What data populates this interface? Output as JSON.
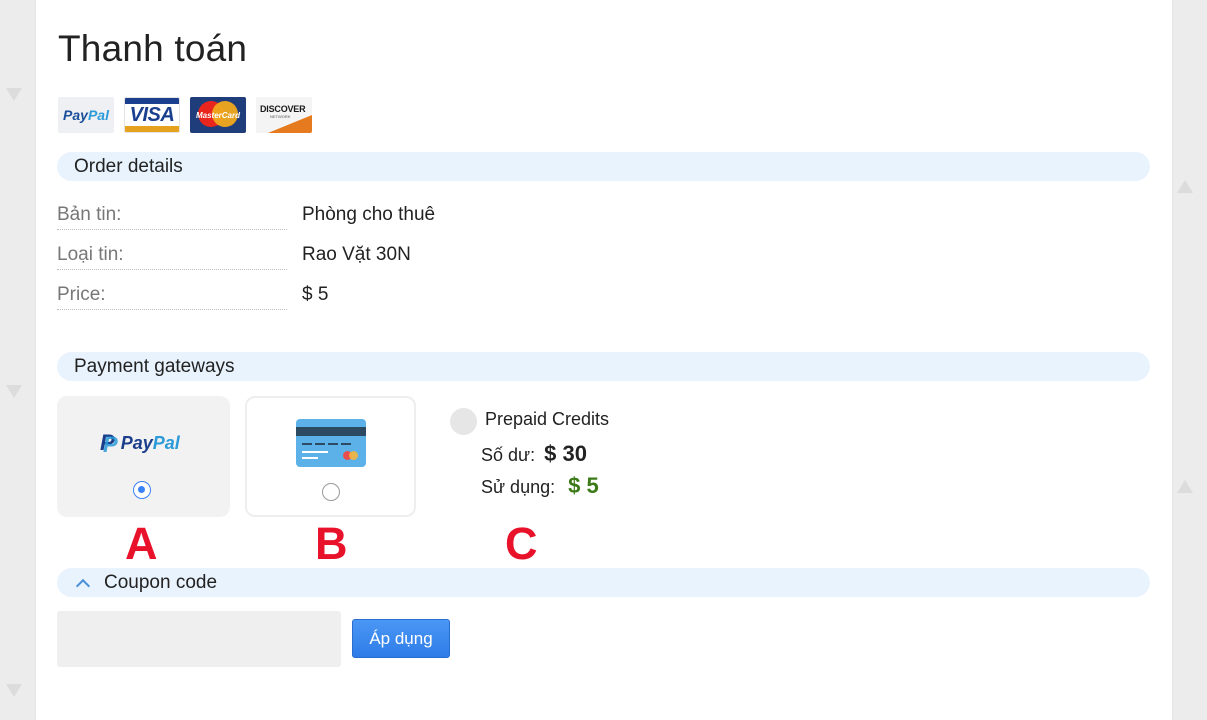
{
  "page": {
    "title": "Thanh toán"
  },
  "accepted_cards": [
    {
      "name": "paypal",
      "label_a": "Pay",
      "label_b": "Pal"
    },
    {
      "name": "visa",
      "label": "VISA"
    },
    {
      "name": "mastercard",
      "label": "MasterCard"
    },
    {
      "name": "discover",
      "label": "DISCOVER",
      "sub": "NETWORK"
    }
  ],
  "order_details": {
    "heading": "Order details",
    "rows": [
      {
        "label": "Bản tin:",
        "value": "Phòng cho thuê"
      },
      {
        "label": "Loại tin:",
        "value": "Rao Vặt 30N"
      },
      {
        "label": "Price:",
        "value": "$ 5"
      }
    ]
  },
  "payment_gateways": {
    "heading": "Payment gateways",
    "paypal": {
      "logo_a": "Pay",
      "logo_b": "Pal",
      "selected": true
    },
    "card": {
      "selected": false
    },
    "prepaid": {
      "title": "Prepaid Credits",
      "balance_label": "Số dư:",
      "balance_value": "$ 30",
      "use_label": "Sử dụng:",
      "use_value": "$ 5",
      "selected": false
    }
  },
  "annotations": {
    "a": "A",
    "b": "B",
    "c": "C"
  },
  "coupon": {
    "heading": "Coupon code",
    "input_value": "",
    "placeholder": "",
    "apply_label": "Áp dụng"
  },
  "colors": {
    "accent": "#3b82f6",
    "section_bg": "#e9f3fd",
    "annotation_red": "#e8132b",
    "use_value_green": "#3b7a17"
  }
}
